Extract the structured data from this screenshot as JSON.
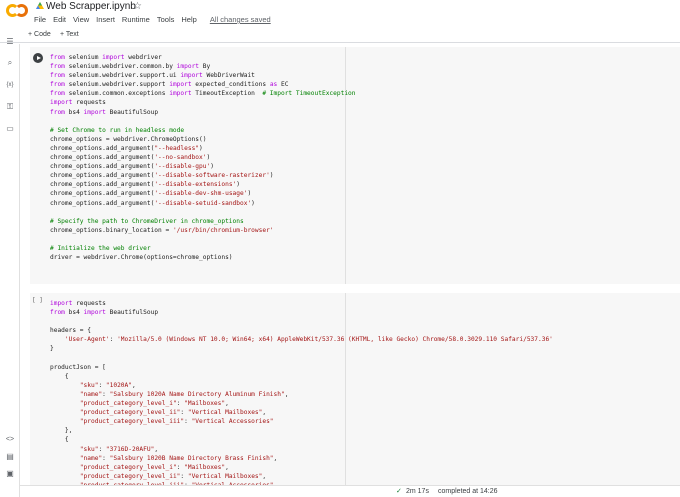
{
  "header": {
    "title": "Web Scrapper.ipynb",
    "menu": [
      "File",
      "Edit",
      "View",
      "Insert",
      "Runtime",
      "Tools",
      "Help"
    ],
    "saved": "All changes saved"
  },
  "toolbar": {
    "code_label": "+ Code",
    "text_label": "+ Text"
  },
  "sidebar": {
    "icons": [
      "toc-icon",
      "search-icon",
      "variables-icon",
      "key-icon",
      "folder-icon",
      "code-snippets-icon",
      "command-palette-icon",
      "terminal-icon"
    ]
  },
  "cell1": {
    "lines": [
      "from selenium import webdriver",
      "from selenium.webdriver.common.by import By",
      "from selenium.webdriver.support.ui import WebDriverWait",
      "from selenium.webdriver.support import expected_conditions as EC",
      "from selenium.common.exceptions import TimeoutException  # Import TimeoutException",
      "import requests",
      "from bs4 import BeautifulSoup",
      "",
      "# Set Chrome to run in headless mode",
      "chrome_options = webdriver.ChromeOptions()",
      "chrome_options.add_argument(\"--headless\")",
      "chrome_options.add_argument('--no-sandbox')",
      "chrome_options.add_argument('--disable-gpu')",
      "chrome_options.add_argument('--disable-software-rasterizer')",
      "chrome_options.add_argument('--disable-extensions')",
      "chrome_options.add_argument('--disable-dev-shm-usage')",
      "chrome_options.add_argument('--disable-setuid-sandbox')",
      "",
      "# Specify the path to ChromeDriver in chrome_options",
      "chrome_options.binary_location = '/usr/bin/chromium-browser'",
      "",
      "# Initialize the web driver",
      "driver = webdriver.Chrome(options=chrome_options)"
    ]
  },
  "cell2": {
    "exec_count": "[ ]",
    "lines": [
      "import requests",
      "from bs4 import BeautifulSoup",
      "",
      "headers = {",
      "    'User-Agent': 'Mozilla/5.0 (Windows NT 10.0; Win64; x64) AppleWebKit/537.36 (KHTML, like Gecko) Chrome/58.0.3029.110 Safari/537.36'",
      "}",
      "",
      "productJson = [",
      "    {",
      "        \"sku\": \"1020A\",",
      "        \"name\": \"Salsbury 1020A Name Directory Aluminum Finish\",",
      "        \"product_category_level_i\": \"Mailboxes\",",
      "        \"product_category_level_ii\": \"Vertical Mailboxes\",",
      "        \"product_category_level_iii\": \"Vertical Accessories\"",
      "    },",
      "    {",
      "        \"sku\": \"3716D-20AFU\",",
      "        \"name\": \"Salsbury 1020B Name Directory Brass Finish\",",
      "        \"product_category_level_i\": \"Mailboxes\",",
      "        \"product_category_level_ii\": \"Vertical Mailboxes\",",
      "        \"product_category_level_iii\": \"Vertical Accessories\""
    ]
  },
  "status": {
    "check": "✓",
    "duration": "2m 17s",
    "completed": "completed at 14:26"
  }
}
